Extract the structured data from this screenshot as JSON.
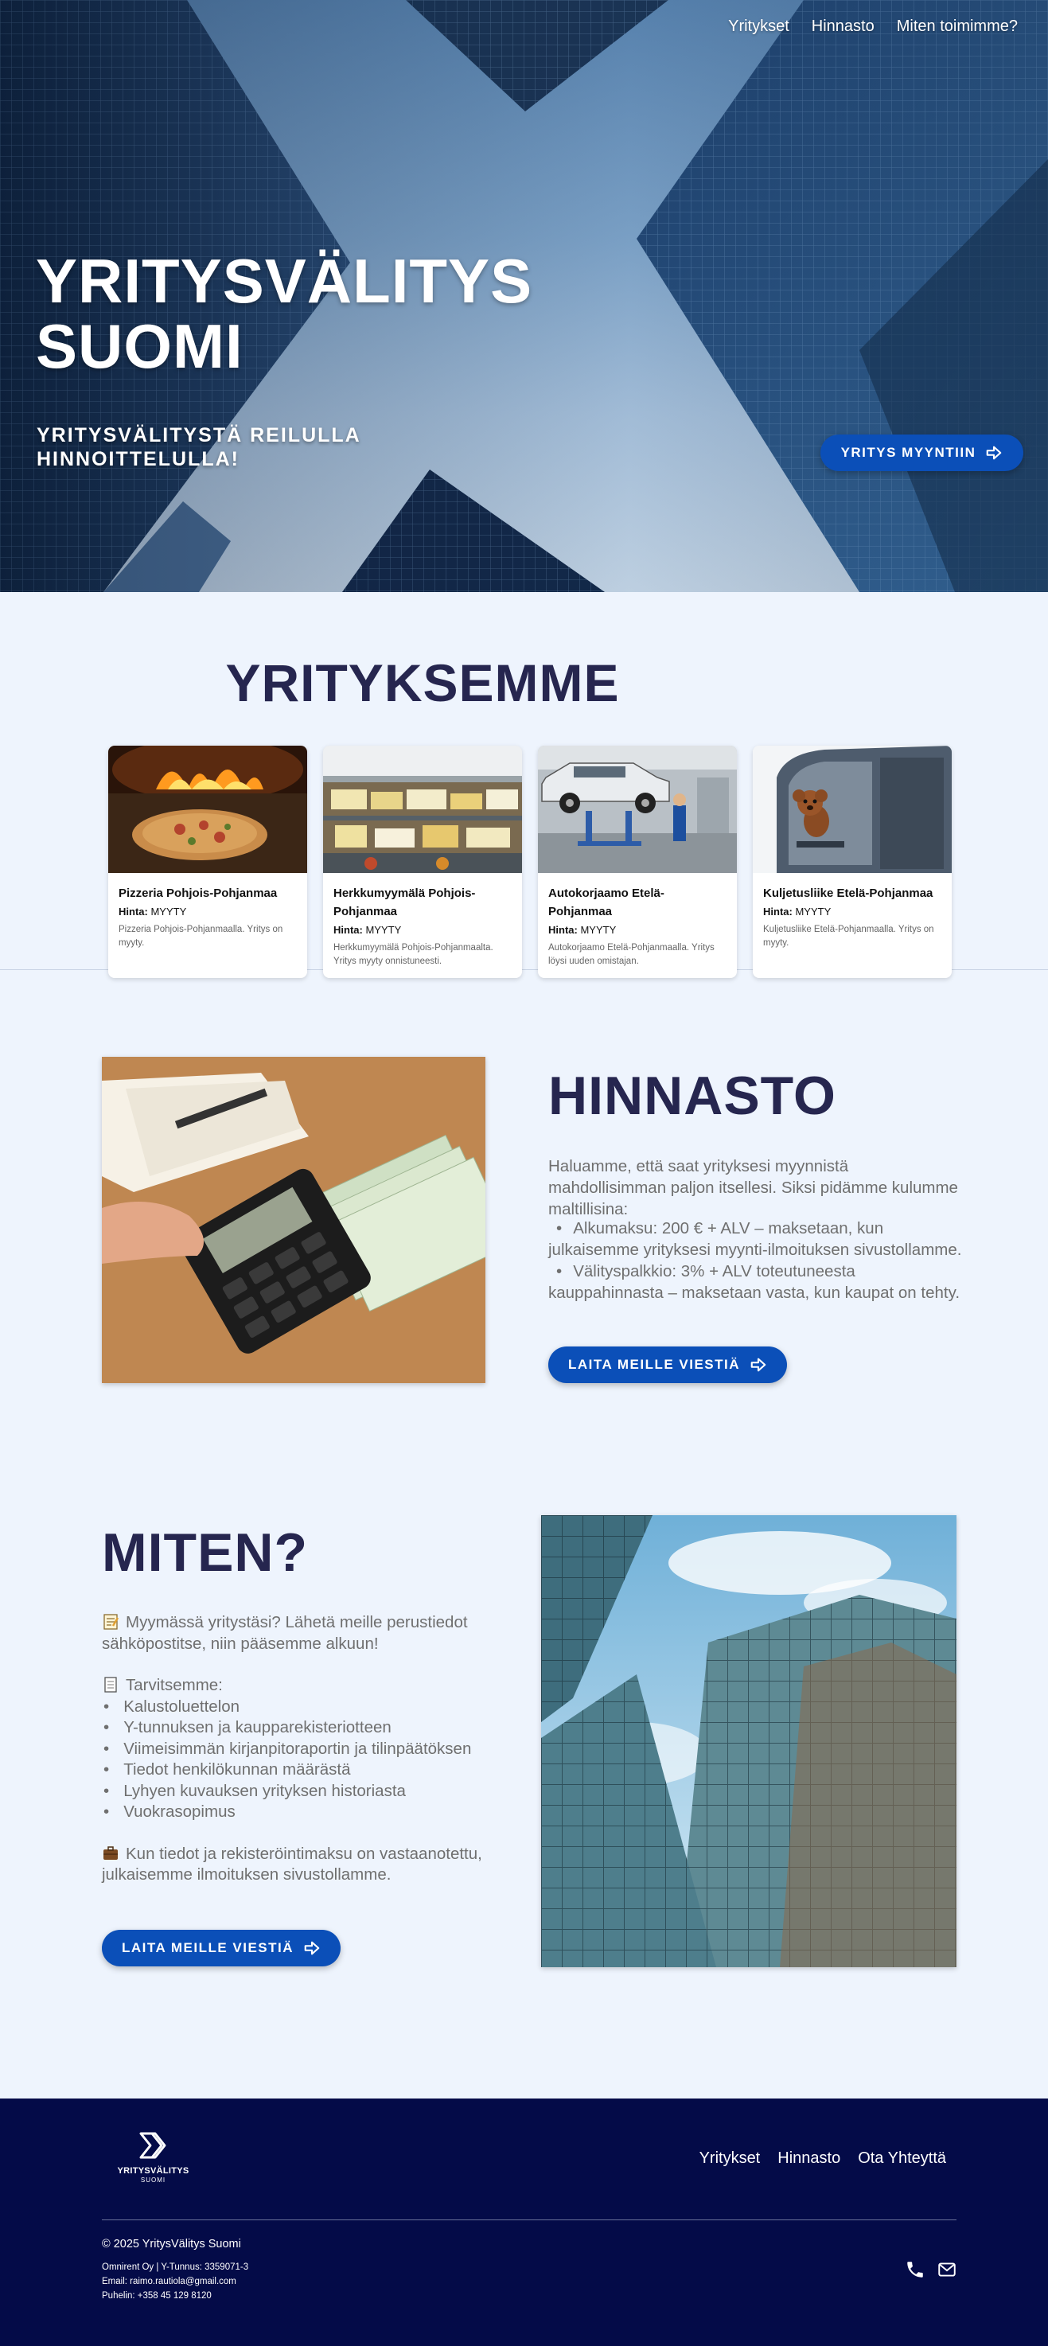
{
  "nav": {
    "items": [
      "Yritykset",
      "Hinnasto",
      "Miten toimimme?"
    ]
  },
  "hero": {
    "title_line1": "YRITYSVÄLITYS",
    "title_line2": "SUOMI",
    "subtitle_line1": "YRITYSVÄLITYSTÄ REILULLA",
    "subtitle_line2": "HINNOITTELULLA!",
    "button_label": "YRITYS MYYNTIIN"
  },
  "companies": {
    "title": "YRITYKSEMME",
    "cards": [
      {
        "name": "Pizzeria Pohjois-Pohjanmaa",
        "price_label": "Hinta:",
        "price": "MYYTY",
        "description": "Pizzeria Pohjois-Pohjanmaalla. Yritys on myyty.",
        "image": "pizza-oven"
      },
      {
        "name": "Herkkumyymälä Pohjois-Pohjanmaa",
        "price_label": "Hinta:",
        "price": "MYYTY",
        "description": "Herkkumyymälä Pohjois-Pohjanmaalta. Yritys myyty onnistuneesti.",
        "image": "deli-counter"
      },
      {
        "name": "Autokorjaamo Etelä-Pohjanmaa",
        "price_label": "Hinta:",
        "price": "MYYTY",
        "description": "Autokorjaamo Etelä-Pohjanmaalla. Yritys löysi uuden omistajan.",
        "image": "car-on-lift"
      },
      {
        "name": "Kuljetusliike Etelä-Pohjanmaa",
        "price_label": "Hinta:",
        "price": "MYYTY",
        "description": "Kuljetusliike Etelä-Pohjanmaalla. Yritys on myyty.",
        "image": "dog-in-truck"
      }
    ]
  },
  "pricing": {
    "title": "HINNASTO",
    "intro": "Haluamme, että saat yrityksesi myynnistä mahdollisimman paljon itsellesi. Siksi pidämme kulumme maltillisina:",
    "items": [
      "Alkumaksu: 200 € + ALV – maksetaan, kun julkaisemme yrityksesi myynti-ilmoituksen sivustollamme.",
      "Välityspalkkio: 3% + ALV toteutuneesta kauppahinnasta – maksetaan vasta, kun kaupat on tehty."
    ],
    "button_label": "LAITA MEILLE VIESTIÄ"
  },
  "how": {
    "title": "MITEN?",
    "intro": "Myymässä yritystäsi? Lähetä meille perustiedot sähköpostitse, niin pääsemme alkuun!",
    "needs_title": "Tarvitsemme:",
    "needs": [
      "Kalustoluettelon",
      "Y-tunnuksen ja kaupparekisteriotteen",
      "Viimeisimmän kirjanpitoraportin ja tilinpäätöksen",
      "Tiedot henkilökunnan määrästä",
      "Lyhyen kuvauksen yrityksen historiasta",
      "Vuokrasopimus"
    ],
    "outro": "Kun tiedot ja rekisteröintimaksu on vastaanotettu, julkaisemme ilmoituksen sivustollamme.",
    "button_label": "LAITA MEILLE VIESTIÄ"
  },
  "footer": {
    "logo_line1": "YRITYSVÄLITYS",
    "logo_line2": "SUOMI",
    "nav": [
      "Yritykset",
      "Hinnasto",
      "Ota Yhteyttä"
    ],
    "copyright": "© 2025 YritysVälitys Suomi",
    "company": "Omnirent Oy | Y-Tunnus: 3359071-3",
    "email": "Email: raimo.rautiola@gmail.com",
    "phone": "Puhelin: +358 45 129 8120"
  },
  "colors": {
    "accent": "#0b4fb8",
    "heading": "#26264f",
    "footer_bg": "#040b48",
    "page_bg": "#eef4fd"
  },
  "icons": [
    "arrow-right-icon",
    "phone-icon",
    "mail-icon",
    "memo-icon",
    "page-icon",
    "briefcase-icon",
    "logo-chevron-icon"
  ]
}
